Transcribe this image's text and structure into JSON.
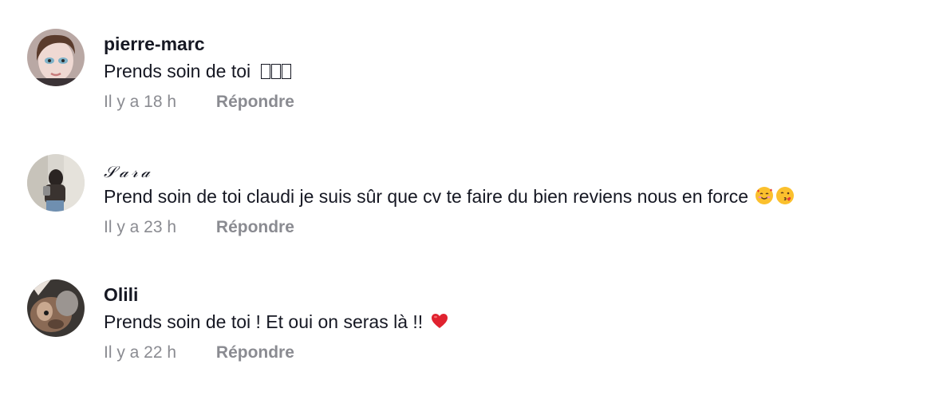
{
  "comments": [
    {
      "username": "pierre-marc",
      "text": "Prends soin de toi",
      "time": "Il y a 18 h",
      "reply_label": "Répondre",
      "trailing_glyphs": "unsupported-emoji-boxes"
    },
    {
      "username": "𝒮𝒶𝓇𝒶",
      "text": "Prend soin de toi claudi je suis sûr que cv te faire du bien reviens nous en force",
      "time": "Il y a 23 h",
      "reply_label": "Répondre",
      "trailing_emojis": [
        "smiling-face-with-hearts-emoji",
        "face-blowing-kiss-emoji"
      ]
    },
    {
      "username": "Olili",
      "text": "Prends soin de toi ! Et oui on seras là !!",
      "time": "Il y a 22 h",
      "reply_label": "Répondre",
      "trailing_emojis": [
        "red-heart-emoji"
      ]
    }
  ],
  "colors": {
    "text": "#161823",
    "muted": "#8a8b91",
    "background": "#ffffff",
    "heart": "#e0222f"
  }
}
